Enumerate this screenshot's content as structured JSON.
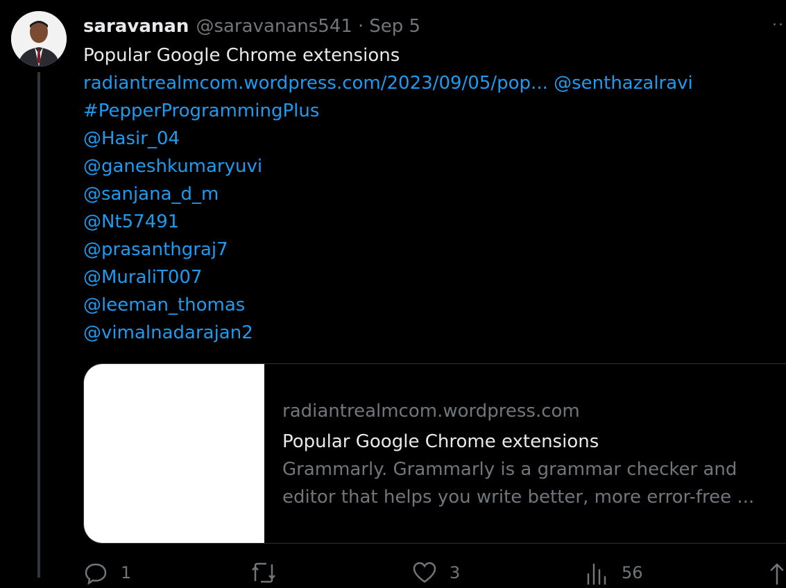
{
  "author": {
    "name": "saravanan",
    "handle": "@saravanans541",
    "separator": "·",
    "date": "Sep 5",
    "avatar_icon": "profile-photo"
  },
  "more_icon": "more-dots-icon",
  "more_label": "··",
  "tweet": {
    "text": "Popular Google Chrome extensions",
    "url": "radiantrealmcom.wordpress.com/2023/09/05/pop...",
    "mention_1": "@senthazalravi",
    "hashtag": "#PepperProgrammingPlus",
    "mentions": [
      "@Hasir_04",
      "@ganeshkumaryuvi",
      "@sanjana_d_m",
      "@Nt57491",
      "@prasanthgraj7",
      "@MuraliT007",
      "@leeman_thomas",
      "@vimalnadarajan2"
    ]
  },
  "card": {
    "domain": "radiantrealmcom.wordpress.com",
    "title": "Popular Google Chrome extensions",
    "description_line1": "Grammarly. Grammarly is a grammar checker and",
    "description_line2": "editor that helps you write better, more error-free ..."
  },
  "actions": {
    "reply_count": "1",
    "retweet_count": "",
    "like_count": "3",
    "views_count": "56"
  },
  "colors": {
    "background": "#000000",
    "text": "#e7e9ea",
    "secondary": "#71767b",
    "link": "#1d9bf0",
    "border": "#2f3336"
  }
}
